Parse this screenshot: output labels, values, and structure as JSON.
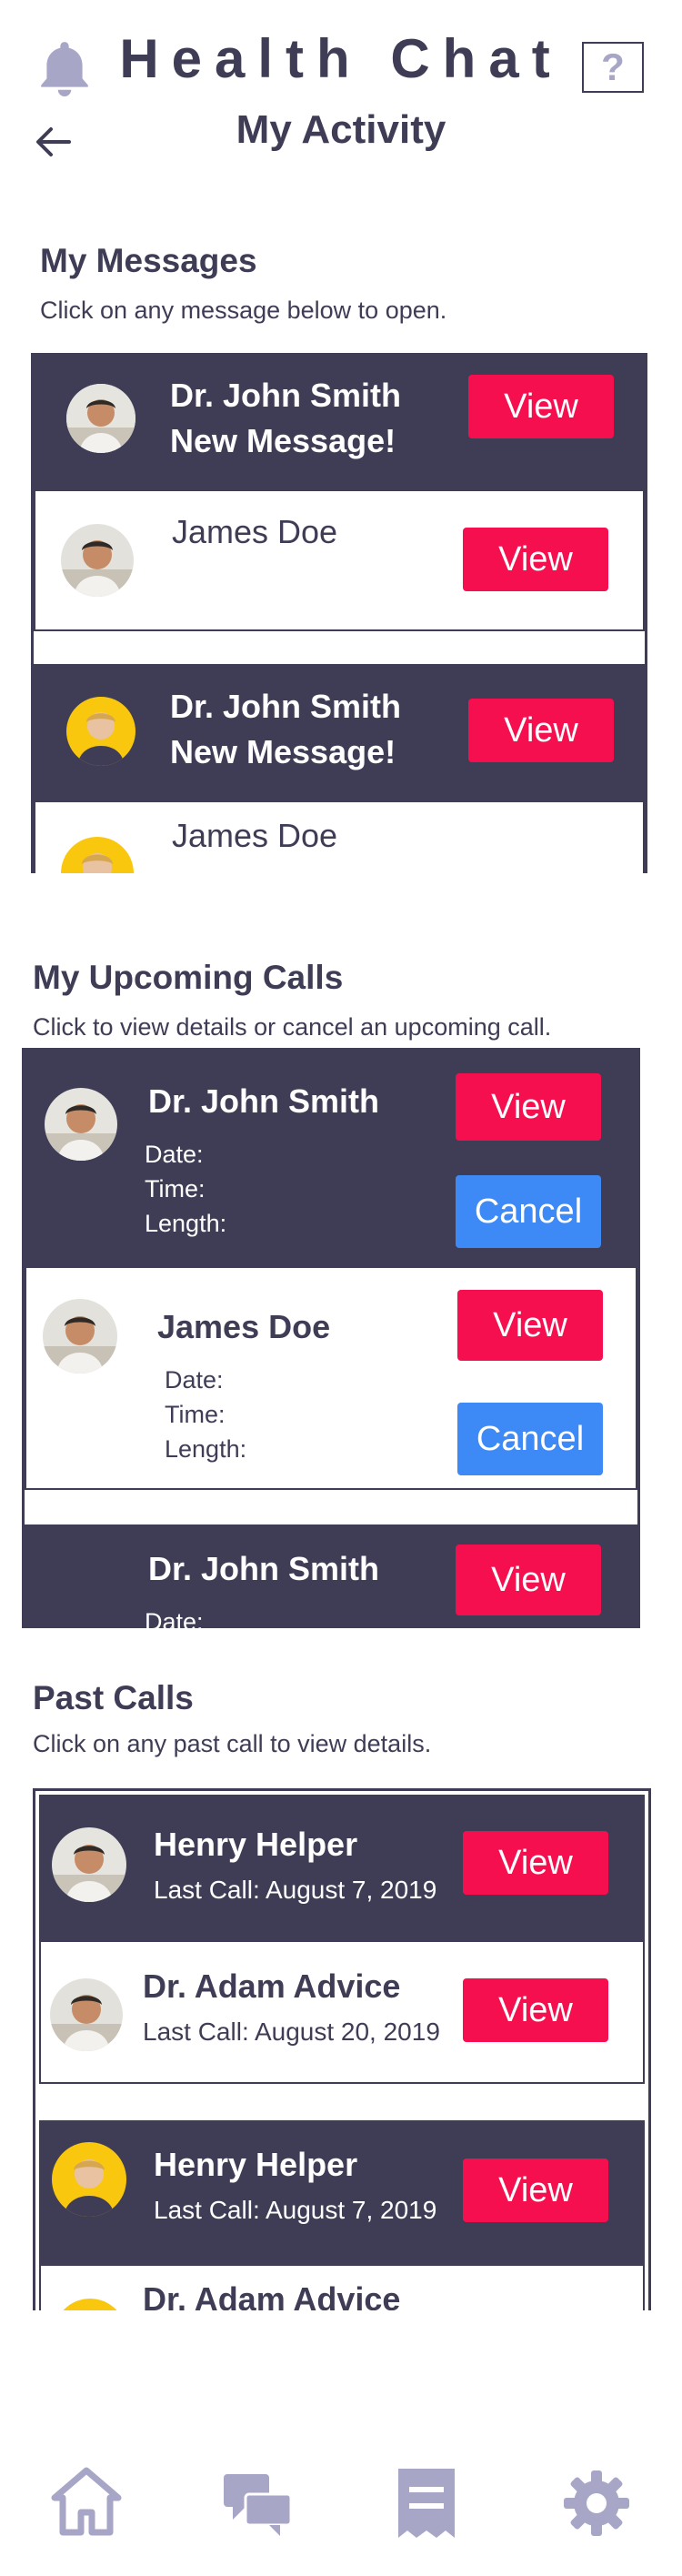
{
  "header": {
    "app_title": "Health Chat",
    "help_label": "?",
    "page_title": "My Activity"
  },
  "messages": {
    "title": "My Messages",
    "subtitle": "Click on any message below to open.",
    "items": [
      {
        "name": "Dr. John Smith",
        "status": "New Message!",
        "button": "View"
      },
      {
        "name": "James Doe",
        "button": "View"
      },
      {
        "name": "Dr. John Smith",
        "status": "New Message!",
        "button": "View"
      },
      {
        "name": "James Doe"
      }
    ]
  },
  "upcoming": {
    "title": "My Upcoming Calls",
    "subtitle": "Click to view details or cancel an upcoming call.",
    "items": [
      {
        "name": "Dr. John Smith",
        "date_label": "Date:",
        "time_label": "Time:",
        "length_label": "Length:",
        "view": "View",
        "cancel": "Cancel"
      },
      {
        "name": "James Doe",
        "date_label": "Date:",
        "time_label": "Time:",
        "length_label": "Length:",
        "view": "View",
        "cancel": "Cancel"
      },
      {
        "name": "Dr. John Smith",
        "date_label": "Date:",
        "view": "View"
      }
    ]
  },
  "past": {
    "title": "Past Calls",
    "subtitle": "Click on any past call to view details.",
    "items": [
      {
        "name": "Henry Helper",
        "last_call": "Last Call: August 7, 2019",
        "button": "View"
      },
      {
        "name": "Dr. Adam Advice",
        "last_call": "Last Call: August 20, 2019",
        "button": "View"
      },
      {
        "name": "Henry Helper",
        "last_call": "Last Call: August 7, 2019",
        "button": "View"
      },
      {
        "name": "Dr. Adam Advice"
      }
    ]
  },
  "nav": {
    "items": [
      {
        "icon": "home-icon"
      },
      {
        "icon": "chat-icon"
      },
      {
        "icon": "receipt-icon"
      },
      {
        "icon": "gear-icon"
      }
    ],
    "color": "#a8a6c6"
  },
  "colors": {
    "primary": "#3f3d56",
    "view_button": "#f50f4e",
    "cancel_button": "#3d8af7",
    "accent_yellow": "#f9c80e"
  }
}
